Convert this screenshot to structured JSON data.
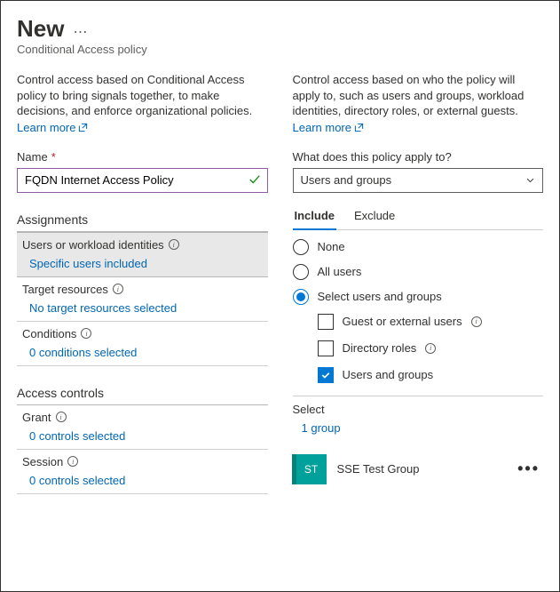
{
  "header": {
    "title": "New",
    "subtitle": "Conditional Access policy"
  },
  "left": {
    "description": "Control access based on Conditional Access policy to bring signals together, to make decisions, and enforce organizational policies.",
    "learn_more": "Learn more",
    "name_label": "Name",
    "name_value": "FQDN Internet Access Policy",
    "assignments_heading": "Assignments",
    "rows": {
      "users": {
        "title": "Users or workload identities",
        "sub": "Specific users included"
      },
      "resources": {
        "title": "Target resources",
        "sub": "No target resources selected"
      },
      "conditions": {
        "title": "Conditions",
        "sub": "0 conditions selected"
      }
    },
    "access_heading": "Access controls",
    "access_rows": {
      "grant": {
        "title": "Grant",
        "sub": "0 controls selected"
      },
      "session": {
        "title": "Session",
        "sub": "0 controls selected"
      }
    }
  },
  "right": {
    "description": "Control access based on who the policy will apply to, such as users and groups, workload identities, directory roles, or external guests.",
    "learn_more": "Learn more",
    "apply_label": "What does this policy apply to?",
    "apply_value": "Users and groups",
    "tabs": {
      "include": "Include",
      "exclude": "Exclude"
    },
    "radios": {
      "none": "None",
      "all": "All users",
      "select": "Select users and groups"
    },
    "checks": {
      "guest": "Guest or external users",
      "dir": "Directory roles",
      "ug": "Users and groups"
    },
    "select_label": "Select",
    "select_link": "1 group",
    "group": {
      "initials": "ST",
      "name": "SSE Test Group"
    }
  }
}
